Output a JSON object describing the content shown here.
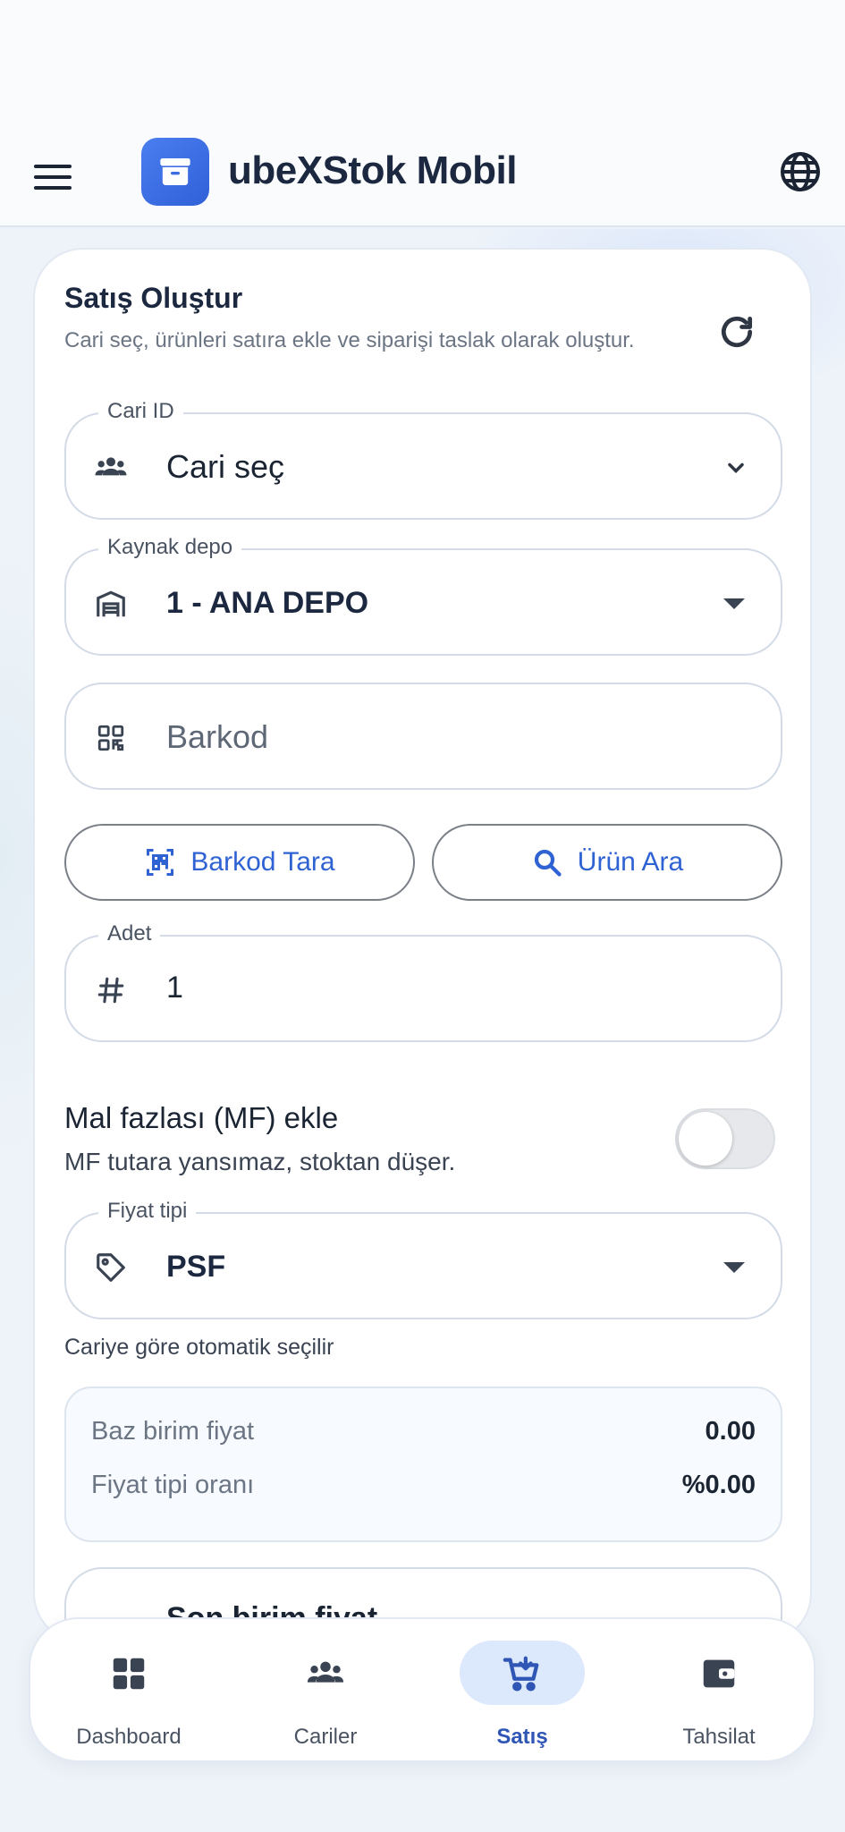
{
  "app": {
    "title": "ubeXStok Mobil"
  },
  "form": {
    "title": "Satış Oluştur",
    "subtitle": "Cari seç, ürünleri satıra ekle ve siparişi taslak olarak oluştur.",
    "cari": {
      "label": "Cari ID",
      "value": "Cari seç"
    },
    "depo": {
      "label": "Kaynak depo",
      "value": "1 - ANA DEPO"
    },
    "barkod": {
      "placeholder": "Barkod"
    },
    "buttons": {
      "scan": "Barkod Tara",
      "search": "Ürün Ara"
    },
    "adet": {
      "label": "Adet",
      "value": "1"
    },
    "mf": {
      "title": "Mal fazlası (MF) ekle",
      "desc": "MF tutara yansımaz, stoktan düşer.",
      "enabled": false
    },
    "fiyat_tipi": {
      "label": "Fiyat tipi",
      "value": "PSF",
      "hint": "Cariye göre otomatik seçilir"
    },
    "price_info": [
      {
        "key": "Baz birim fiyat",
        "value": "0.00"
      },
      {
        "key": "Fiyat tipi oranı",
        "value": "%0.00"
      }
    ],
    "son_birim": {
      "label": "Son birim fiyat"
    }
  },
  "nav": {
    "items": [
      {
        "label": "Dashboard",
        "icon": "dashboard-icon"
      },
      {
        "label": "Cariler",
        "icon": "people-icon"
      },
      {
        "label": "Satış",
        "icon": "cart-icon",
        "active": true
      },
      {
        "label": "Tahsilat",
        "icon": "wallet-icon"
      }
    ]
  },
  "colors": {
    "accent": "#2f62d2",
    "active_nav_bg": "#dce8fb",
    "logo": "#3d6fe3"
  }
}
